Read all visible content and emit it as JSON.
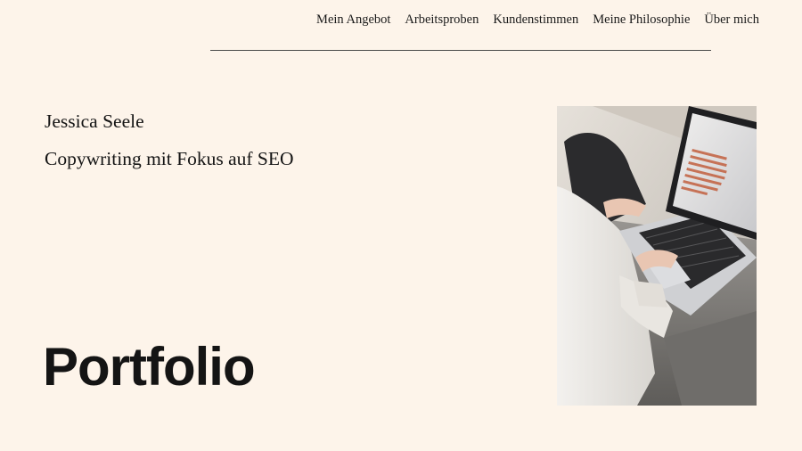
{
  "nav": {
    "items": [
      {
        "label": "Mein Angebot"
      },
      {
        "label": "Arbeitsproben"
      },
      {
        "label": "Kundenstimmen"
      },
      {
        "label": "Meine Philosophie"
      },
      {
        "label": "Über mich"
      }
    ]
  },
  "hero": {
    "name": "Jessica Seele",
    "tagline": "Copywriting mit Fokus auf SEO",
    "title": "Portfolio",
    "photo_icon": "laptop-photo"
  },
  "colors": {
    "background": "#fdf4ea",
    "text": "#141414",
    "rule": "#4a4a4a"
  }
}
